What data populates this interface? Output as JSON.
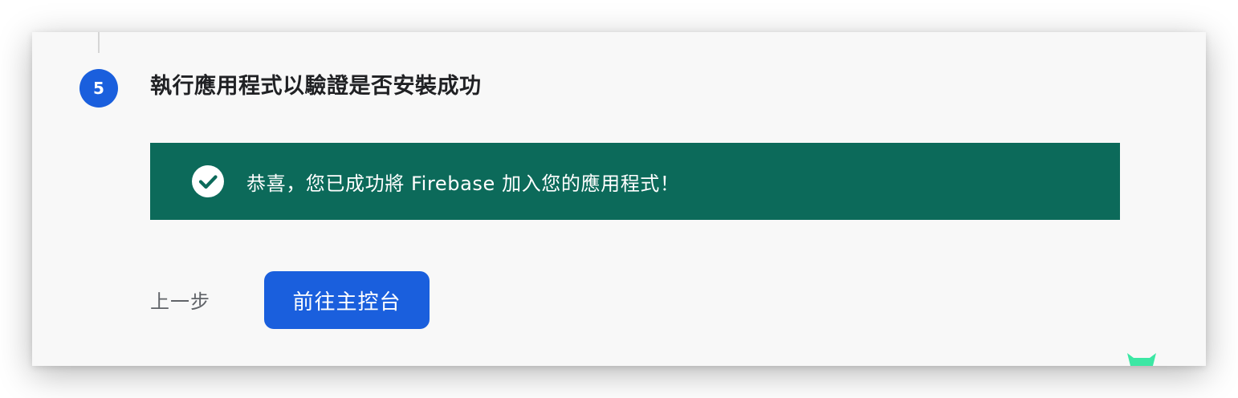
{
  "step": {
    "number": "5",
    "title": "執行應用程式以驗證是否安裝成功"
  },
  "banner": {
    "message": "恭喜，您已成功將 Firebase 加入您的應用程式！",
    "icon": "check-circle-icon",
    "color": "#0c6a5a"
  },
  "actions": {
    "back_label": "上一步",
    "primary_label": "前往主控台",
    "primary_color": "#1a5fdd"
  },
  "decor": {
    "mascot_icon": "mascot-icon",
    "mascot_color": "#3ce7a4"
  }
}
